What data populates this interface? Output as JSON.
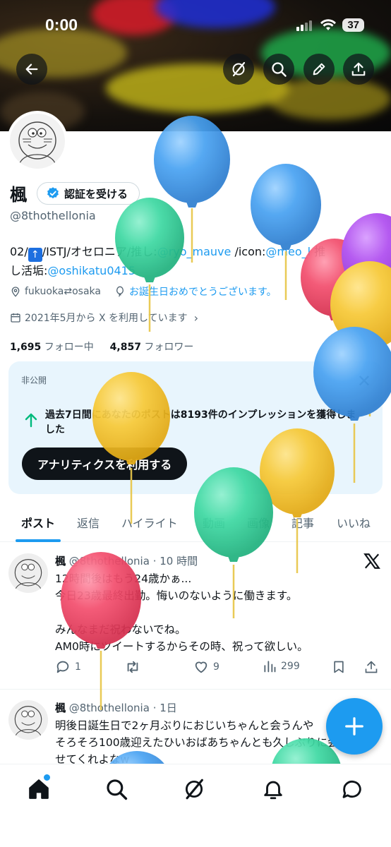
{
  "status_bar": {
    "time": "0:00",
    "battery": "37"
  },
  "profile": {
    "name": "楓",
    "verify_label": "認証を受ける",
    "handle": "@8thothellonia",
    "bio_prefix": "02/",
    "bio_middle": "/ISTJ/オセロニア/推し:",
    "bio_mention1": "@ryo_mauve",
    "bio_icon": " /icon:",
    "bio_mention2": "@meo_l",
    "bio_end": " 推",
    "bio_line2": "し活垢:",
    "bio_mention3": "@oshikatu0415",
    "location": "fukuoka⇄osaka",
    "birthday": "お誕生日おめでとうございます。",
    "joined": "2021年5月から X を利用しています",
    "following_count": "1,695",
    "following_label": "フォロー中",
    "followers_count": "4,857",
    "followers_label": "フォロワー"
  },
  "private_card": {
    "label": "非公開",
    "impressions_text": "過去7日間にあなたのポストは8193件のインプレッションを獲得しました",
    "analytics_button": "アナリティクスを利用する"
  },
  "tabs": [
    "ポスト",
    "返信",
    "ハイライト",
    "動画",
    "画像",
    "記事",
    "いいね"
  ],
  "tweets": [
    {
      "name": "楓",
      "handle": "@8thothellonia",
      "time": "· 10 時間",
      "lines": [
        "12時間後はもう24歳かぁ...",
        "今日23歳最終出勤。悔いのないように働きます。",
        "",
        "みんなまだ祝わないでね。",
        "AM0時にツイートするからその時、祝って欲しい。"
      ],
      "replies": "1",
      "likes": "9",
      "views": "299"
    },
    {
      "name": "楓",
      "handle": "@8thothellonia",
      "time": "· 1日",
      "lines": [
        "明後日誕生日で2ヶ月ぶりにおじいちゃんと会うんや",
        "そろそろ100歳迎えたひいおばあちゃんとも久しぶりに会わ",
        "せてくれよなw"
      ]
    }
  ],
  "colors": {
    "accent": "#1d9bf0",
    "text": "#0f1419",
    "muted": "#536471",
    "card_bg": "#e8f5fd"
  },
  "icons": [
    "back-arrow-icon",
    "grok-icon",
    "search-icon",
    "edit-pencil-icon",
    "share-icon",
    "verified-check-icon",
    "location-icon",
    "balloon-icon",
    "calendar-icon",
    "x-logo-icon",
    "home-icon",
    "notifications-bell-icon",
    "messages-icon",
    "compose-plus-icon"
  ]
}
